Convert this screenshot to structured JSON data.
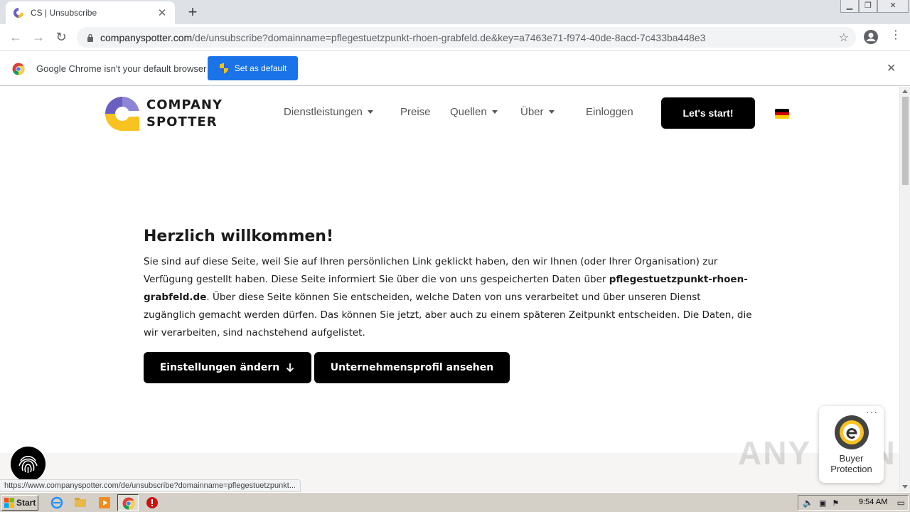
{
  "browser": {
    "tab_title": "CS | Unsubscribe",
    "new_tab_label": "+",
    "url_host": "companyspotter.com",
    "url_rest": "/de/unsubscribe?domainname=pflegestuetzpunkt-rhoen-grabfeld.de&key=a7463e71-f974-40de-8acd-7c433ba448e3",
    "infobar_text": "Google Chrome isn't your default browser",
    "set_default_label": "Set as default",
    "status_url": "https://www.companyspotter.com/de/unsubscribe?domainname=pflegestuetzpunkt..."
  },
  "site": {
    "logo_line1": "COMPANY",
    "logo_line2": "SPOTTER",
    "nav": {
      "services": "Dienstleistungen",
      "pricing": "Preise",
      "sources": "Quellen",
      "about": "Über",
      "login": "Einloggen",
      "cta": "Let's start!"
    },
    "language": "de"
  },
  "main": {
    "heading": "Herzlich willkommen!",
    "para_part1": "Sie sind auf diese Seite, weil Sie auf Ihren persönlichen Link geklickt haben, den wir Ihnen (oder Ihrer Organisation) zur Verfügung gestellt haben. Diese Seite informiert Sie über die von uns gespeicherten Daten über ",
    "para_domain": "pflegestuetzpunkt-rhoen-grabfeld.de",
    "para_part2": ". Über diese Seite können Sie entscheiden, welche Daten von uns verarbeitet und über unseren Dienst zugänglich gemacht werden dürfen. Das können Sie jetzt, aber auch zu einem späteren Zeitpunkt entscheiden. Die Daten, die wir verarbeiten, sind nachstehend aufgelistet.",
    "btn_settings": "Einstellungen ändern",
    "btn_profile": "Unternehmensprofil ansehen"
  },
  "widgets": {
    "trusted_dots": "···",
    "trusted_line1": "Buyer",
    "trusted_line2": "Protection",
    "watermark": "ANY RUN"
  },
  "taskbar": {
    "start_label": "Start",
    "clock": "9:54 AM"
  },
  "colors": {
    "chrome_blue": "#1a73e8",
    "cta_black": "#000000",
    "logo_purple": "#6a5fc1",
    "logo_yellow": "#f8c220"
  }
}
